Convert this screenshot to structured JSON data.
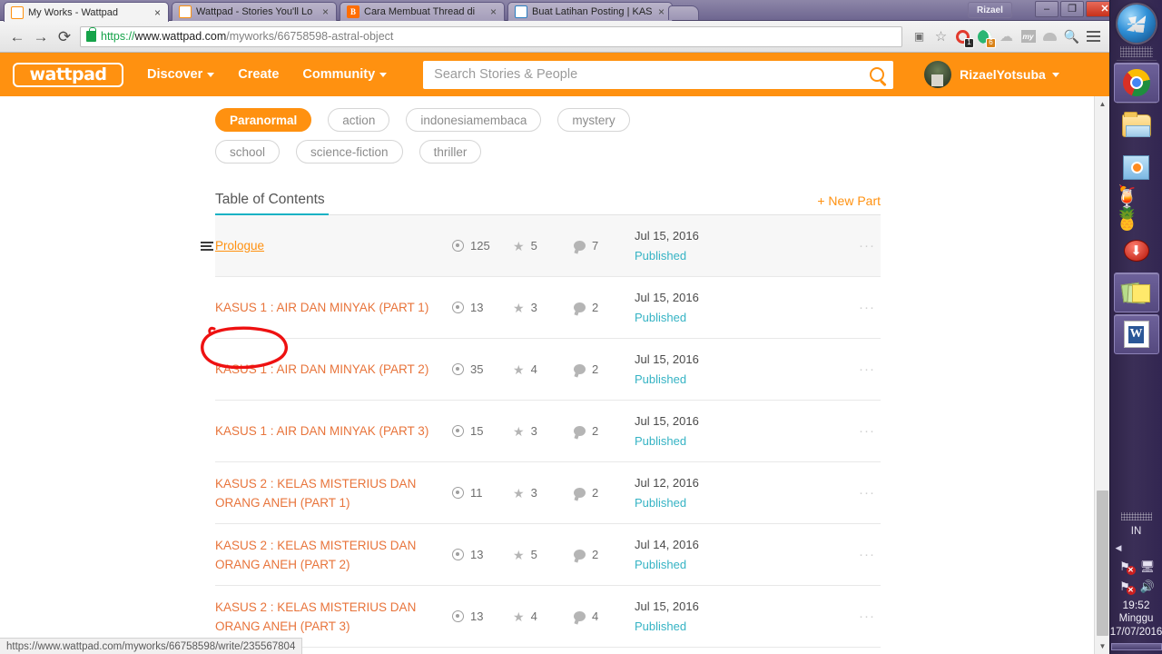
{
  "browser": {
    "tabs": [
      {
        "title": "My Works - Wattpad",
        "favicon": "wattpad-favicon",
        "active": true
      },
      {
        "title": "Wattpad - Stories You'll Lo",
        "favicon": "wattpad-favicon",
        "active": false
      },
      {
        "title": "Cara Membuat Thread di",
        "favicon": "blogger-favicon",
        "active": false
      },
      {
        "title": "Buat Latihan Posting | KAS",
        "favicon": "kaskus-favicon",
        "active": false
      }
    ],
    "close_label": "×",
    "window_user": "Rizael",
    "window_controls": {
      "minimize": "–",
      "maximize": "❐",
      "close": "✕"
    },
    "nav": {
      "back": "←",
      "forward": "→",
      "reload": "⟳"
    },
    "url": {
      "scheme": "https://",
      "host": "www.wattpad.com",
      "path": "/myworks/66758598-astral-object",
      "full": "https://www.wattpad.com/myworks/66758598-astral-object"
    },
    "toolbar_icons": [
      {
        "name": "translate-icon",
        "badge": ""
      },
      {
        "name": "bookmark-star-icon",
        "badge": ""
      },
      {
        "name": "extension-red-ring-icon",
        "badge": "1"
      },
      {
        "name": "extension-green-spiral-icon",
        "badge": "6"
      },
      {
        "name": "extension-cloud-icon",
        "badge": ""
      },
      {
        "name": "extension-my-icon",
        "badge": ""
      },
      {
        "name": "extension-mushroom-icon",
        "badge": ""
      },
      {
        "name": "extension-search-icon",
        "badge": ""
      },
      {
        "name": "chrome-menu-icon",
        "badge": ""
      }
    ],
    "status_bar_url": "https://www.wattpad.com/myworks/66758598/write/235567804"
  },
  "wattpad": {
    "logo": "wattpad",
    "nav": [
      {
        "label": "Discover",
        "has_caret": true
      },
      {
        "label": "Create",
        "has_caret": false
      },
      {
        "label": "Community",
        "has_caret": true
      }
    ],
    "search": {
      "placeholder": "Search Stories & People",
      "value": ""
    },
    "user": {
      "name": "RizaelYotsuba"
    },
    "tags": [
      {
        "label": "Paranormal",
        "primary": true
      },
      {
        "label": "action",
        "primary": false
      },
      {
        "label": "indonesiamembaca",
        "primary": false
      },
      {
        "label": "mystery",
        "primary": false
      },
      {
        "label": "school",
        "primary": false
      },
      {
        "label": "science-fiction",
        "primary": false
      },
      {
        "label": "thriller",
        "primary": false
      }
    ],
    "toc": {
      "title": "Table of Contents",
      "new_part_label": "+ New Part",
      "more_label": "···",
      "rows": [
        {
          "title": "Prologue",
          "reads": "125",
          "votes": "5",
          "comments": "7",
          "date": "Jul 15, 2016",
          "status": "Published",
          "highlight": true,
          "is_link": true,
          "has_handle": true
        },
        {
          "title": "KASUS 1 : AIR DAN MINYAK (PART 1)",
          "reads": "13",
          "votes": "3",
          "comments": "2",
          "date": "Jul 15, 2016",
          "status": "Published",
          "highlight": false,
          "is_link": false,
          "has_handle": false
        },
        {
          "title": "KASUS 1 : AIR DAN MINYAK (PART 2)",
          "reads": "35",
          "votes": "4",
          "comments": "2",
          "date": "Jul 15, 2016",
          "status": "Published",
          "highlight": false,
          "is_link": false,
          "has_handle": false
        },
        {
          "title": "KASUS 1 : AIR DAN MINYAK (PART 3)",
          "reads": "15",
          "votes": "3",
          "comments": "2",
          "date": "Jul 15, 2016",
          "status": "Published",
          "highlight": false,
          "is_link": false,
          "has_handle": false
        },
        {
          "title": "KASUS 2 : KELAS MISTERIUS DAN ORANG ANEH (PART 1)",
          "reads": "11",
          "votes": "3",
          "comments": "2",
          "date": "Jul 12, 2016",
          "status": "Published",
          "highlight": false,
          "is_link": false,
          "has_handle": false
        },
        {
          "title": "KASUS 2 : KELAS MISTERIUS DAN ORANG ANEH (PART 2)",
          "reads": "13",
          "votes": "5",
          "comments": "2",
          "date": "Jul 14, 2016",
          "status": "Published",
          "highlight": false,
          "is_link": false,
          "has_handle": false
        },
        {
          "title": "KASUS 2 : KELAS MISTERIUS DAN ORANG ANEH (PART 3)",
          "reads": "13",
          "votes": "4",
          "comments": "4",
          "date": "Jul 15, 2016",
          "status": "Published",
          "highlight": false,
          "is_link": false,
          "has_handle": false
        }
      ]
    }
  },
  "annotation": {
    "shape": "red-ellipse",
    "target": "Prologue",
    "color": "#ee1111"
  },
  "taskbar": {
    "start_label": "Start",
    "apps": [
      {
        "name": "chrome",
        "active": true
      },
      {
        "name": "file-explorer",
        "active": false
      },
      {
        "name": "media-player",
        "active": false
      },
      {
        "name": "drink-pineapple-app",
        "active": false
      },
      {
        "name": "downloader",
        "active": false
      },
      {
        "name": "sticky-notes",
        "active": true
      },
      {
        "name": "microsoft-word",
        "active": true
      }
    ],
    "tray": {
      "language": "IN",
      "expand": "◀",
      "icons": [
        "network-error-icon",
        "monitor-icon",
        "action-center-error-icon",
        "volume-icon"
      ],
      "time": "19:52",
      "day": "Minggu",
      "date": "17/07/2016"
    }
  },
  "colors": {
    "wattpad_orange": "#ff9110",
    "teal_underline": "#16b2c4",
    "status_teal": "#35b3c4",
    "annotation_red": "#ee1111",
    "taskbar_purple": "#3b2f57"
  }
}
